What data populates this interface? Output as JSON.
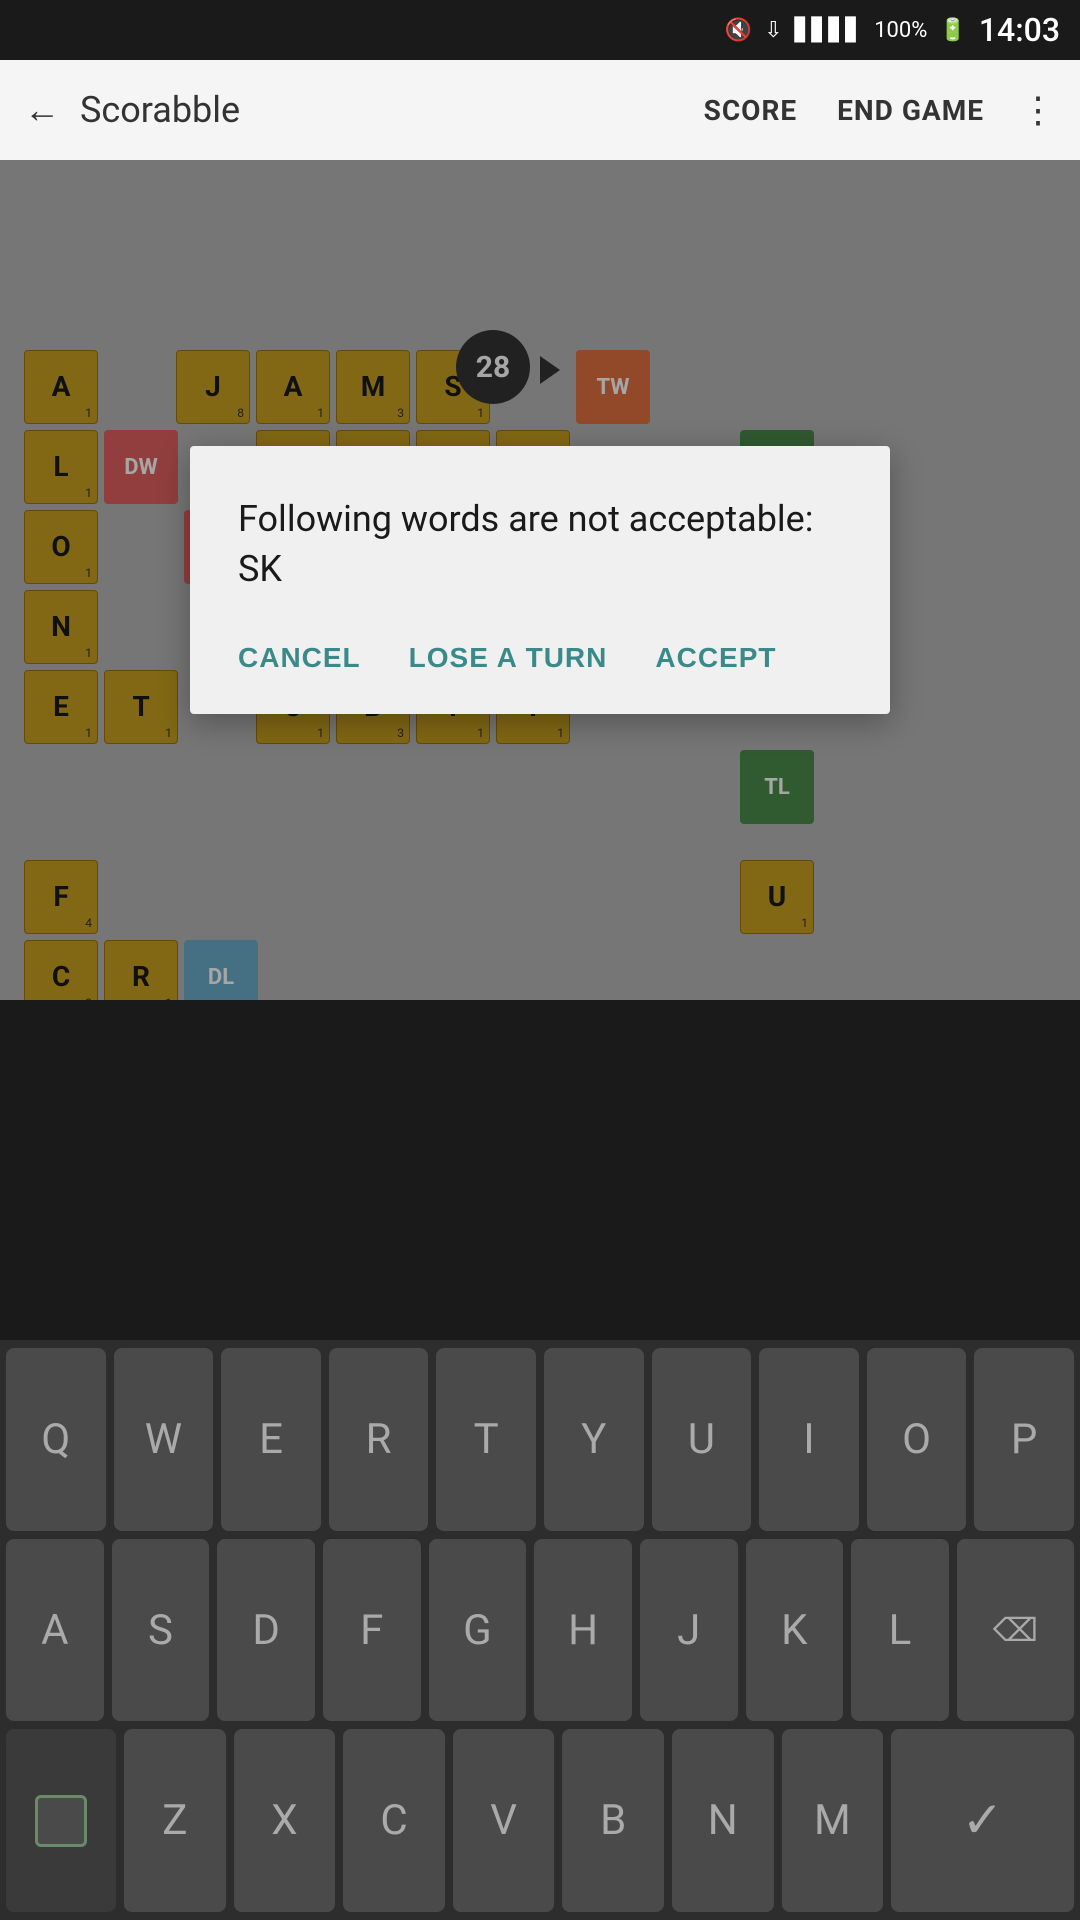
{
  "statusBar": {
    "time": "14:03",
    "battery": "100%",
    "mute_icon": "🔇",
    "wifi_icon": "wifi",
    "signal_icon": "signal"
  },
  "topBar": {
    "back_label": "←",
    "title": "Scorabble",
    "score_label": "SCORE",
    "end_game_label": "END GAME",
    "more_label": "⋮"
  },
  "board": {
    "score_badge": "28"
  },
  "dialog": {
    "message": "Following words are not acceptable: SK",
    "cancel_label": "CANCEL",
    "lose_turn_label": "LOSE A TURN",
    "accept_label": "ACCEPT"
  },
  "keyboard": {
    "row1": [
      "Q",
      "W",
      "E",
      "R",
      "T",
      "Y",
      "U",
      "I",
      "O",
      "P"
    ],
    "row2": [
      "A",
      "S",
      "D",
      "F",
      "G",
      "H",
      "J",
      "K",
      "L"
    ],
    "row3": [
      "Z",
      "X",
      "C",
      "V",
      "B",
      "N",
      "M"
    ],
    "backspace": "⌫",
    "check": "✓"
  }
}
